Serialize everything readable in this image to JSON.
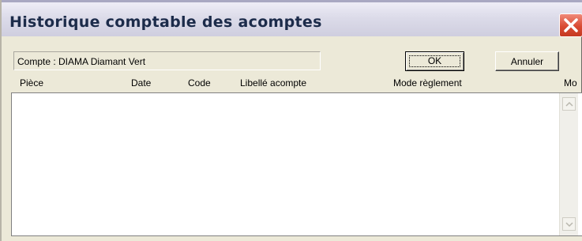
{
  "window": {
    "title": "Historique comptable des acomptes",
    "close_icon": "close-icon"
  },
  "account": {
    "label": "Compte : DIAMA Diamant Vert"
  },
  "buttons": {
    "ok": "OK",
    "cancel": "Annuler"
  },
  "columns": [
    "Pièce",
    "Date",
    "Code",
    "Libellé acompte",
    "Mode règlement",
    "Mo"
  ],
  "rows": [],
  "scrollbar": {
    "up_icon": "scroll-up-arrow-icon",
    "down_icon": "scroll-down-arrow-icon"
  },
  "colors": {
    "close_button": "#d94a32",
    "title_text": "#1c2b4a",
    "dialog_bg": "#ece9d8"
  }
}
